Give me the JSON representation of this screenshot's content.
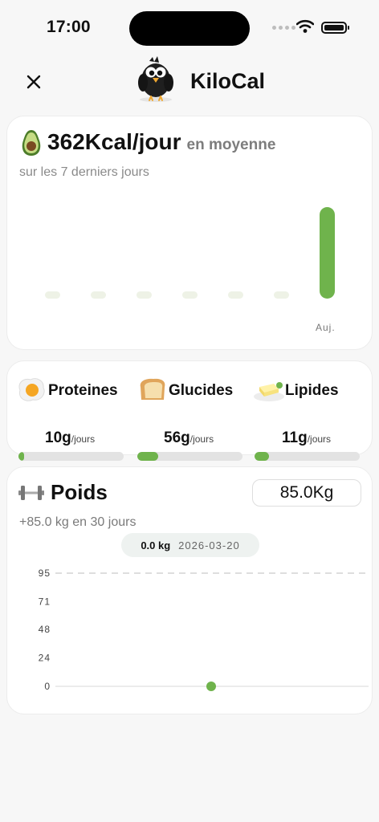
{
  "status_bar": {
    "time": "17:00"
  },
  "header": {
    "title": "KiloCal"
  },
  "calories": {
    "value": "362Kcal/jour",
    "suffix": "en moyenne",
    "subtitle": "sur les 7 derniers jours",
    "today_label": "Auj.",
    "days": [
      {
        "kcal": 0
      },
      {
        "kcal": 0
      },
      {
        "kcal": 0
      },
      {
        "kcal": 0
      },
      {
        "kcal": 0
      },
      {
        "kcal": 0
      },
      {
        "kcal": 2534
      }
    ]
  },
  "macros": [
    {
      "name": "Proteines",
      "value": "10g",
      "unit": "/jours",
      "progress": 0.05
    },
    {
      "name": "Glucides",
      "value": "56g",
      "unit": "/jours",
      "progress": 0.2
    },
    {
      "name": "Lipides",
      "value": "11g",
      "unit": "/jours",
      "progress": 0.14
    }
  ],
  "weight": {
    "title": "Poids",
    "current": "85.0Kg",
    "change": "+85.0 kg en 30 jours",
    "tooltip": {
      "value": "0.0 kg",
      "date": "2026-03-20"
    },
    "chart_data": {
      "type": "line",
      "x": [
        "2026-03-20"
      ],
      "series": [
        {
          "values": [
            0
          ]
        }
      ],
      "ylim": [
        0,
        95
      ],
      "yticks": [
        "95",
        "71",
        "48",
        "24",
        "0"
      ],
      "target_line": 95
    }
  },
  "colors": {
    "accent": "#6fb34c",
    "empty_bar": "#eef2e6",
    "background": "#f7f7f7"
  }
}
